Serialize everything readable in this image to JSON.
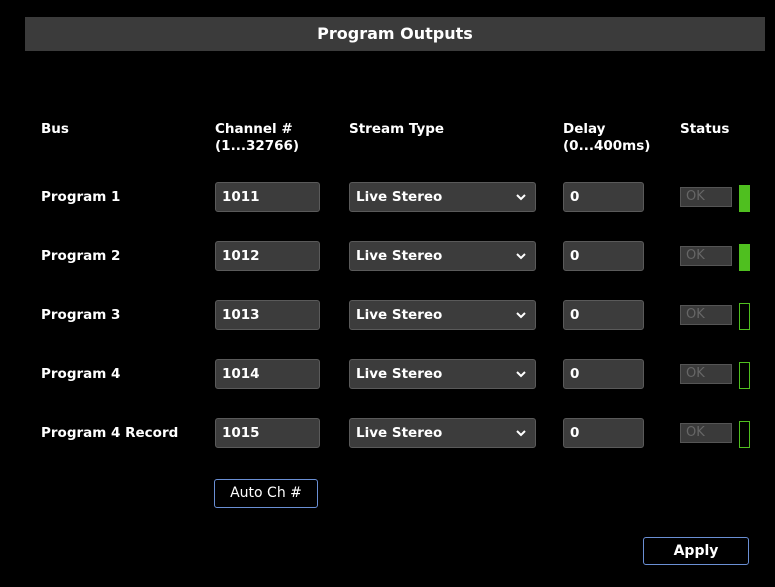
{
  "title": "Program Outputs",
  "headers": {
    "bus": "Bus",
    "channel": "Channel #\n(1...32766)",
    "stream_type": "Stream Type",
    "delay": "Delay\n(0...400ms)",
    "status": "Status"
  },
  "rows": [
    {
      "bus": "Program 1",
      "channel": "1011",
      "stream_type": "Live Stereo",
      "delay": "0",
      "status": "OK",
      "active": true
    },
    {
      "bus": "Program 2",
      "channel": "1012",
      "stream_type": "Live Stereo",
      "delay": "0",
      "status": "OK",
      "active": true
    },
    {
      "bus": "Program 3",
      "channel": "1013",
      "stream_type": "Live Stereo",
      "delay": "0",
      "status": "OK",
      "active": false
    },
    {
      "bus": "Program 4",
      "channel": "1014",
      "stream_type": "Live Stereo",
      "delay": "0",
      "status": "OK",
      "active": false
    },
    {
      "bus": "Program 4 Record",
      "channel": "1015",
      "stream_type": "Live Stereo",
      "delay": "0",
      "status": "OK",
      "active": false
    }
  ],
  "buttons": {
    "auto_channel": "Auto Ch #",
    "apply": "Apply"
  },
  "icons": {
    "dropdown": "chevron-down-icon",
    "status_led": "status-led"
  },
  "colors": {
    "background": "#000000",
    "title_bar": "#3b3b3b",
    "field_bg": "#3c3c3c",
    "led_active": "#4fbf1f",
    "led_inactive_border": "#4fbf1f",
    "button_border": "#6a8fd4"
  }
}
